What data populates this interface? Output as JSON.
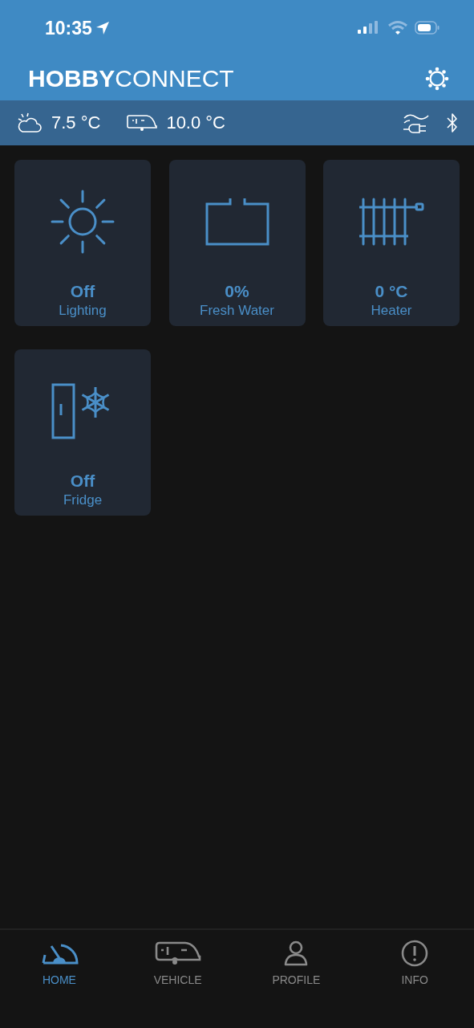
{
  "status_bar": {
    "time": "10:35"
  },
  "header": {
    "logo": "**HOBBY**CONNECT"
  },
  "info_bar": {
    "outside_temperature": "7.5 °C",
    "vehicle_temperature": "10.0 °C"
  },
  "tiles": [
    {
      "kind": "lighting",
      "value": "Off",
      "label": "Lighting"
    },
    {
      "kind": "water",
      "value": "0%",
      "label": "Fresh Water"
    },
    {
      "kind": "heater",
      "value": "0 °C",
      "label": "Heater"
    },
    {
      "kind": "fridge",
      "value": "Off",
      "label": "Fridge"
    }
  ],
  "tabs": [
    {
      "kind": "home",
      "label": "HOME",
      "selected": true
    },
    {
      "kind": "vehicle",
      "label": "VEHICLE",
      "selected": false
    },
    {
      "kind": "profile",
      "label": "PROFILE",
      "selected": false
    },
    {
      "kind": "info",
      "label": "INFO",
      "selected": false
    }
  ]
}
